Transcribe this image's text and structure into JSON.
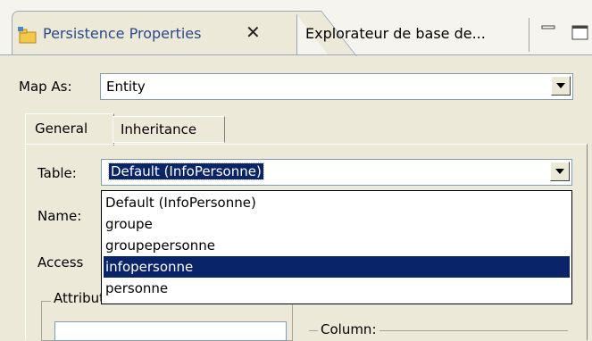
{
  "tabs": {
    "active_title": "Persistence Properties",
    "close_glyph": "✕",
    "second_title": "Explorateur de base de..."
  },
  "map_as": {
    "label": "Map As:",
    "value": "Entity"
  },
  "inner_tabs": [
    "General",
    "Inheritance"
  ],
  "table": {
    "label": "Table:",
    "value": "Default (InfoPersonne)",
    "options": [
      "Default (InfoPersonne)",
      "groupe",
      "groupepersonne",
      "infopersonne",
      "personne"
    ],
    "highlighted_index": 3
  },
  "name_label": "Name:",
  "access_label": "Access",
  "attributes_group_label": "Attributes Overrides:",
  "column_label": "Column:",
  "colors": {
    "selection": "#0a246a",
    "panel": "#ece9d8",
    "tab_title": "#2a4a8a"
  }
}
